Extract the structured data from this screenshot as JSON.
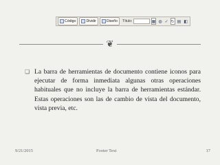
{
  "toolbar": {
    "buttons": [
      {
        "label": "Código",
        "icon": "code-view-icon"
      },
      {
        "label": "Dividir",
        "icon": "split-view-icon"
      },
      {
        "label": "Diseño",
        "icon": "design-view-icon"
      }
    ],
    "title_label": "Título:",
    "title_value": "",
    "icons": [
      "file-management-icon",
      "globe-preview-icon",
      "check-icon",
      "refresh-icon",
      "view-options-icon",
      "visual-aids-icon"
    ]
  },
  "content": {
    "ornament": "❦",
    "bullet_symbol": "❏",
    "paragraph": "La barra de herramientas de documento contiene iconos para ejecutar de forma inmediata algunas otras operaciones habituales que no incluye la barra de herramientas estándar. Estas operaciones son las de cambio de vista del documento, vista previa, etc."
  },
  "footer": {
    "date": "9/21/2015",
    "text": "Footer Text",
    "page": "17"
  }
}
